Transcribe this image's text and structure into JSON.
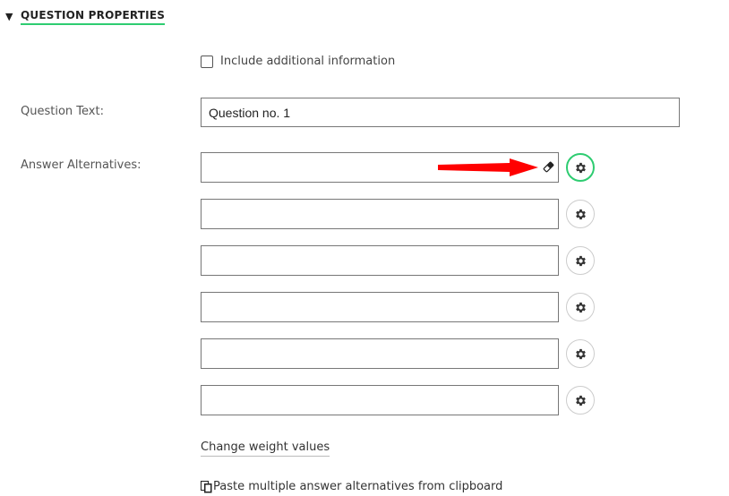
{
  "section": {
    "toggle_glyph": "▼",
    "title": "QUESTION PROPERTIES"
  },
  "include_additional": {
    "label": "Include additional information",
    "checked": false
  },
  "question_text": {
    "label": "Question Text:",
    "value": "Question no. 1"
  },
  "answers": {
    "label": "Answer Alternatives:",
    "items": [
      {
        "value": "",
        "settings_icon": "gear-icon"
      },
      {
        "value": "",
        "settings_icon": "gear-icon"
      },
      {
        "value": "",
        "settings_icon": "gear-icon"
      },
      {
        "value": "",
        "settings_icon": "gear-icon"
      },
      {
        "value": "",
        "settings_icon": "gear-icon"
      },
      {
        "value": "",
        "settings_icon": "gear-icon"
      }
    ]
  },
  "links": {
    "change_weight": "Change weight values",
    "paste_clipboard": "Paste multiple answer alternatives from clipboard"
  },
  "colors": {
    "accent": "#2ecc71",
    "annotation_arrow": "#ff0000"
  }
}
